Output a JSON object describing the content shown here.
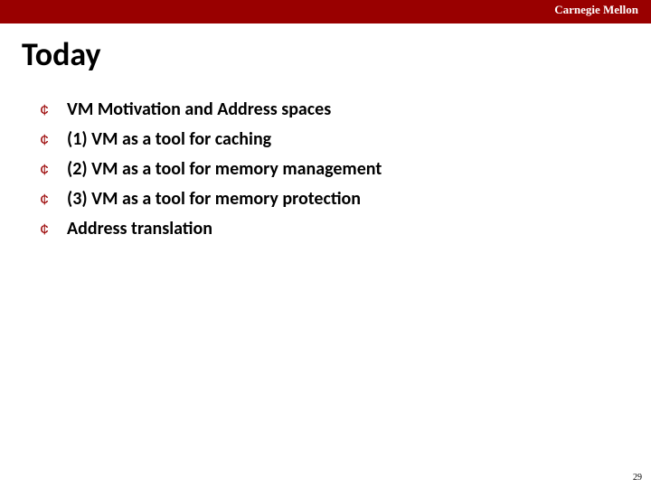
{
  "brand": "Carnegie Mellon",
  "title": "Today",
  "bullets": [
    "VM Motivation and Address spaces",
    "(1) VM as a tool for caching",
    "(2) VM as a tool for memory management",
    "(3) VM as a tool for memory protection",
    "Address translation"
  ],
  "page_number": "29",
  "bullet_mark": "¢"
}
